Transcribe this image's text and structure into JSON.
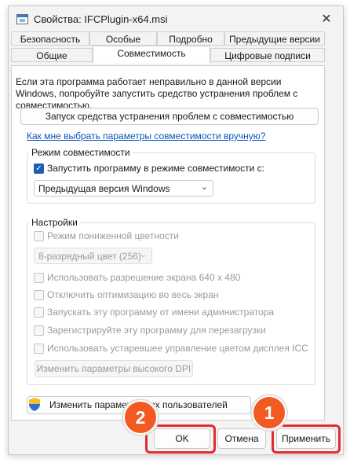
{
  "window": {
    "title": "Свойства: IFCPlugin-x64.msi",
    "close_glyph": "✕"
  },
  "tabs": {
    "row1": [
      "Безопасность",
      "Особые",
      "Подробно",
      "Предыдущие версии"
    ],
    "row2": [
      "Общие",
      "Совместимость",
      "Цифровые подписи"
    ],
    "active": "Совместимость"
  },
  "intro_text": "Если эта программа работает неправильно в данной версии Windows, попробуйте запустить средство устранения проблем с совместимостью.",
  "troubleshooter_button": "Запуск средства устранения проблем с совместимостью",
  "manual_link": "Как мне выбрать параметры совместимости вручную?",
  "compat_group": {
    "legend": "Режим совместимости",
    "checkbox_label": "Запустить программу в режиме совместимости с:",
    "checked": true,
    "select_value": "Предыдущая версия Windows"
  },
  "settings_group": {
    "legend": "Настройки",
    "reduced_color": "Режим пониженной цветности",
    "color_select": "8-разрядный цвет (256)",
    "res_640": "Использовать разрешение экрана 640 x 480",
    "disable_fullscreen": "Отключить оптимизацию во весь экран",
    "run_as_admin": "Запускать эту программу от имени администратора",
    "register_restart": "Зарегистрируйте эту программу для перезагрузки",
    "legacy_icc": "Использовать устаревшее управление цветом дисплея ICC",
    "dpi_button": "Изменить параметры высокого DPI"
  },
  "all_users_button": "Изменить парамет... всех пользователей",
  "buttons": {
    "ok": "OK",
    "cancel": "Отмена",
    "apply": "Применить"
  },
  "annotations": {
    "badge_1": "1",
    "badge_2": "2",
    "color": "#e32c2c",
    "badge_color": "#f25a22"
  },
  "colors": {
    "accent": "#1a5fb4",
    "link": "#0a55b8"
  }
}
